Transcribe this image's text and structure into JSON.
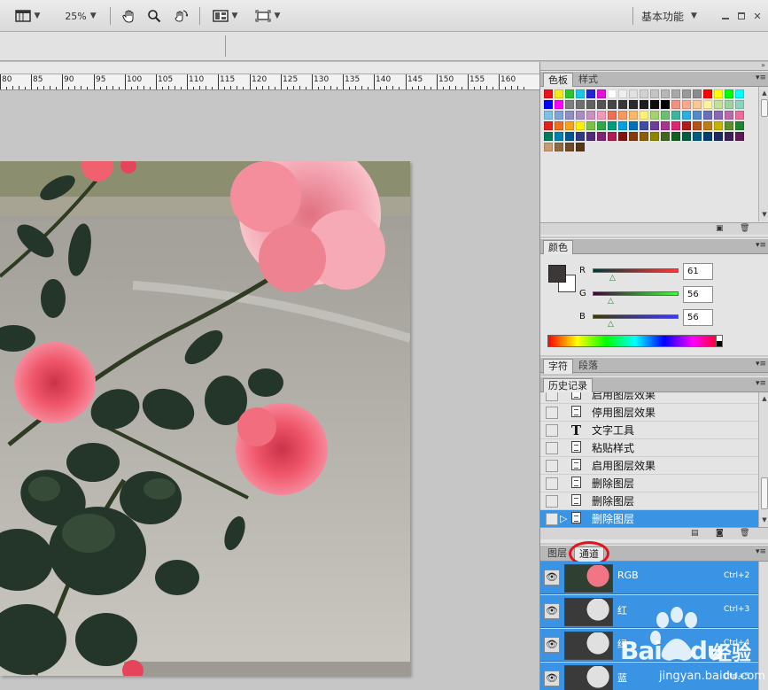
{
  "appbar": {
    "zoom": "25%",
    "workspace": "基本功能"
  },
  "ruler": {
    "labels": [
      "80",
      "85",
      "90",
      "95",
      "100",
      "105",
      "110",
      "115",
      "120",
      "125",
      "130",
      "135",
      "140",
      "145",
      "150",
      "155",
      "160"
    ]
  },
  "swatches_panel": {
    "tabs": [
      "色板",
      "样式"
    ],
    "colors_row1": [
      "#e6141c",
      "#f2ea1b",
      "#2ec52b",
      "#18c6e8",
      "#2026d6",
      "#e40fd9",
      "#ffffff",
      "#efefef",
      "#e1e1e1",
      "#d2d2d2",
      "#c4c4c4",
      "#b6b6b6",
      "#a8a8a8",
      "#9a9a9a",
      "#8c8c8c",
      "#ff0000",
      "#ffff00",
      "#00ff00",
      "#00ffff"
    ],
    "colors_row2": [
      "#0000ff",
      "#ff00ff",
      "#7e7e7e",
      "#707070",
      "#626262",
      "#545454",
      "#464646",
      "#383838",
      "#2a2a2a",
      "#1c1c1c",
      "#0e0e0e",
      "#000000",
      "#f3927e",
      "#f8a98c",
      "#fbc793",
      "#fff29c",
      "#c3e09a",
      "#9dd3a1",
      "#8fd1c1"
    ],
    "colors_row3": [
      "#7ac3e6",
      "#7da5d8",
      "#8e8fc6",
      "#a78dc3",
      "#c891c3",
      "#f197b9",
      "#ef6e58",
      "#f59a5e",
      "#f9b863",
      "#fff176",
      "#a4d36c",
      "#6ebd74",
      "#3fb49c",
      "#2aaee6",
      "#528bcb",
      "#6a6fb7",
      "#8b68b1",
      "#b96aae",
      "#e76e9c"
    ],
    "colors_row4": [
      "#e2211c",
      "#ee6f20",
      "#f6a21a",
      "#ffef00",
      "#7cc344",
      "#2ea844",
      "#009b7b",
      "#00a1e0",
      "#0070b9",
      "#3e4ea4",
      "#6b3c98",
      "#a5358f",
      "#e0256f",
      "#b01c1b",
      "#b45219",
      "#bb7e16",
      "#c3b500",
      "#5c8e2e",
      "#22832f"
    ],
    "colors_row5": [
      "#007b5e",
      "#0080ad",
      "#005791",
      "#2f3a7f",
      "#532c77",
      "#7e2571",
      "#ae1a52",
      "#7f1312",
      "#823c11",
      "#8a5c0c",
      "#8e8400",
      "#406622",
      "#135e22",
      "#005b42",
      "#005f80",
      "#00406c",
      "#1e2a5d",
      "#3b1f57",
      "#5d1a53"
    ],
    "colors_row6": [
      "#c79b6c",
      "#8e6a43",
      "#6e4b25",
      "#563615"
    ],
    "scroll_up": "▲",
    "scroll_down": "▼",
    "new_icon": "new-swatch-icon",
    "trash_icon": "trash-icon"
  },
  "color_panel": {
    "tab": "颜色",
    "channels": [
      {
        "label": "R",
        "value": "61",
        "fraction": 0.239,
        "gradient": "linear-gradient(to right, #003838, #ff3838)"
      },
      {
        "label": "G",
        "value": "56",
        "fraction": 0.22,
        "gradient": "linear-gradient(to right, #3d0038, #3dff38)"
      },
      {
        "label": "B",
        "value": "56",
        "fraction": 0.22,
        "gradient": "linear-gradient(to right, #3d3800, #3d38ff)"
      }
    ],
    "foreground": "#3d3838",
    "background": "#ffffff"
  },
  "char_panel": {
    "tabs": [
      "字符",
      "段落"
    ]
  },
  "history_panel": {
    "tab": "历史记录",
    "items": [
      {
        "label": "启用图层效果",
        "icon": "doc",
        "selected": false,
        "partial": true
      },
      {
        "label": "停用图层效果",
        "icon": "doc",
        "selected": false
      },
      {
        "label": "文字工具",
        "icon": "T",
        "selected": false
      },
      {
        "label": "粘贴样式",
        "icon": "doc",
        "selected": false
      },
      {
        "label": "启用图层效果",
        "icon": "doc",
        "selected": false
      },
      {
        "label": "删除图层",
        "icon": "doc",
        "selected": false
      },
      {
        "label": "删除图层",
        "icon": "doc",
        "selected": false
      },
      {
        "label": "删除图层",
        "icon": "doc",
        "selected": true
      }
    ]
  },
  "layers_panel": {
    "tabs": [
      "图层",
      "通道"
    ],
    "channels": [
      {
        "name": "RGB",
        "shortcut": "Ctrl+2"
      },
      {
        "name": "红",
        "shortcut": "Ctrl+3"
      },
      {
        "name": "绿",
        "shortcut": "Ctrl+4"
      },
      {
        "name": "蓝",
        "shortcut": "Ctrl+5"
      }
    ]
  },
  "watermark": {
    "brand": "Bai",
    "brand2": "du",
    "product": "经验",
    "url": "jingyan.baidu.com"
  }
}
